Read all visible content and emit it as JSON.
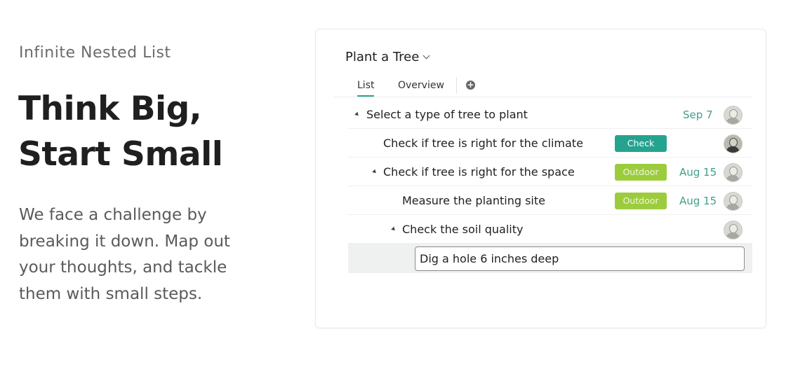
{
  "hero": {
    "eyebrow": "Infinite Nested List",
    "headline_line1": "Think Big,",
    "headline_line2": "Start Small",
    "body": "We face a challenge by breaking it down. Map out your thoughts, and tackle them with small steps."
  },
  "project": {
    "title": "Plant a Tree",
    "tabs": [
      {
        "label": "List",
        "active": true
      },
      {
        "label": "Overview",
        "active": false
      }
    ],
    "add_tab_icon": "plus-circle-icon"
  },
  "tasks": [
    {
      "text": "Select a type of tree to plant",
      "expanded": true,
      "tag": "",
      "date": "Sep 7",
      "avatar": "avatar-man-glasses"
    },
    {
      "text": "Check if tree is right for the climate",
      "tag": "Check",
      "tag_color": "#26a38f",
      "date": "",
      "avatar": "avatar-woman"
    },
    {
      "text": "Check if tree is right for the space",
      "expanded": true,
      "tag": "Outdoor",
      "tag_color": "#9ccc3e",
      "date": "Aug 15",
      "avatar": "avatar-man"
    },
    {
      "text": "Measure the planting site",
      "tag": "Outdoor",
      "tag_color": "#9ccc3e",
      "date": "Aug 15",
      "avatar": "avatar-man"
    },
    {
      "text": "Check the soil quality",
      "expanded": true,
      "tag": "",
      "date": "",
      "avatar": "avatar-man"
    }
  ],
  "editing": {
    "value": "Dig a hole 6 inches deep"
  }
}
